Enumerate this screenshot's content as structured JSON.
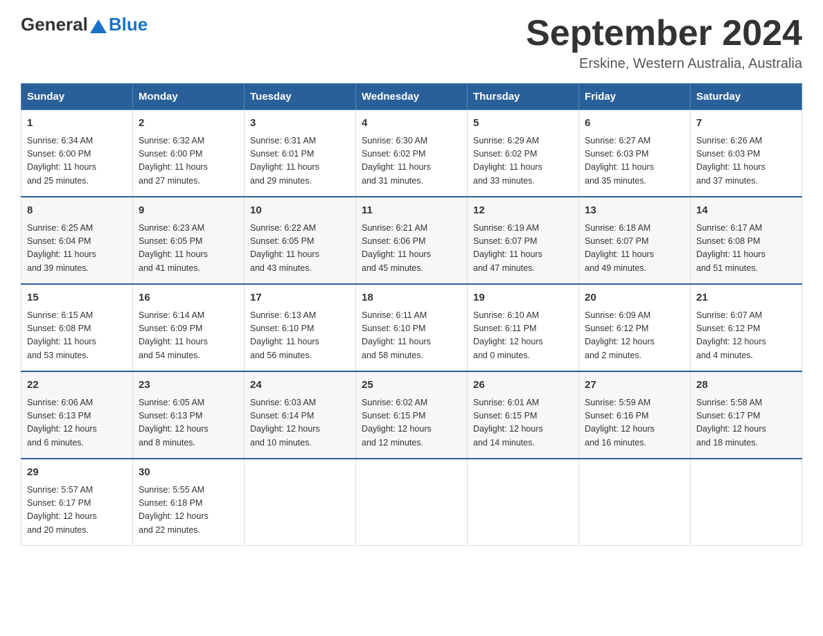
{
  "header": {
    "logo_general": "General",
    "logo_blue": "Blue",
    "month_title": "September 2024",
    "location": "Erskine, Western Australia, Australia"
  },
  "weekdays": [
    "Sunday",
    "Monday",
    "Tuesday",
    "Wednesday",
    "Thursday",
    "Friday",
    "Saturday"
  ],
  "weeks": [
    [
      {
        "day": "1",
        "sunrise": "6:34 AM",
        "sunset": "6:00 PM",
        "daylight": "11 hours and 25 minutes."
      },
      {
        "day": "2",
        "sunrise": "6:32 AM",
        "sunset": "6:00 PM",
        "daylight": "11 hours and 27 minutes."
      },
      {
        "day": "3",
        "sunrise": "6:31 AM",
        "sunset": "6:01 PM",
        "daylight": "11 hours and 29 minutes."
      },
      {
        "day": "4",
        "sunrise": "6:30 AM",
        "sunset": "6:02 PM",
        "daylight": "11 hours and 31 minutes."
      },
      {
        "day": "5",
        "sunrise": "6:29 AM",
        "sunset": "6:02 PM",
        "daylight": "11 hours and 33 minutes."
      },
      {
        "day": "6",
        "sunrise": "6:27 AM",
        "sunset": "6:03 PM",
        "daylight": "11 hours and 35 minutes."
      },
      {
        "day": "7",
        "sunrise": "6:26 AM",
        "sunset": "6:03 PM",
        "daylight": "11 hours and 37 minutes."
      }
    ],
    [
      {
        "day": "8",
        "sunrise": "6:25 AM",
        "sunset": "6:04 PM",
        "daylight": "11 hours and 39 minutes."
      },
      {
        "day": "9",
        "sunrise": "6:23 AM",
        "sunset": "6:05 PM",
        "daylight": "11 hours and 41 minutes."
      },
      {
        "day": "10",
        "sunrise": "6:22 AM",
        "sunset": "6:05 PM",
        "daylight": "11 hours and 43 minutes."
      },
      {
        "day": "11",
        "sunrise": "6:21 AM",
        "sunset": "6:06 PM",
        "daylight": "11 hours and 45 minutes."
      },
      {
        "day": "12",
        "sunrise": "6:19 AM",
        "sunset": "6:07 PM",
        "daylight": "11 hours and 47 minutes."
      },
      {
        "day": "13",
        "sunrise": "6:18 AM",
        "sunset": "6:07 PM",
        "daylight": "11 hours and 49 minutes."
      },
      {
        "day": "14",
        "sunrise": "6:17 AM",
        "sunset": "6:08 PM",
        "daylight": "11 hours and 51 minutes."
      }
    ],
    [
      {
        "day": "15",
        "sunrise": "6:15 AM",
        "sunset": "6:08 PM",
        "daylight": "11 hours and 53 minutes."
      },
      {
        "day": "16",
        "sunrise": "6:14 AM",
        "sunset": "6:09 PM",
        "daylight": "11 hours and 54 minutes."
      },
      {
        "day": "17",
        "sunrise": "6:13 AM",
        "sunset": "6:10 PM",
        "daylight": "11 hours and 56 minutes."
      },
      {
        "day": "18",
        "sunrise": "6:11 AM",
        "sunset": "6:10 PM",
        "daylight": "11 hours and 58 minutes."
      },
      {
        "day": "19",
        "sunrise": "6:10 AM",
        "sunset": "6:11 PM",
        "daylight": "12 hours and 0 minutes."
      },
      {
        "day": "20",
        "sunrise": "6:09 AM",
        "sunset": "6:12 PM",
        "daylight": "12 hours and 2 minutes."
      },
      {
        "day": "21",
        "sunrise": "6:07 AM",
        "sunset": "6:12 PM",
        "daylight": "12 hours and 4 minutes."
      }
    ],
    [
      {
        "day": "22",
        "sunrise": "6:06 AM",
        "sunset": "6:13 PM",
        "daylight": "12 hours and 6 minutes."
      },
      {
        "day": "23",
        "sunrise": "6:05 AM",
        "sunset": "6:13 PM",
        "daylight": "12 hours and 8 minutes."
      },
      {
        "day": "24",
        "sunrise": "6:03 AM",
        "sunset": "6:14 PM",
        "daylight": "12 hours and 10 minutes."
      },
      {
        "day": "25",
        "sunrise": "6:02 AM",
        "sunset": "6:15 PM",
        "daylight": "12 hours and 12 minutes."
      },
      {
        "day": "26",
        "sunrise": "6:01 AM",
        "sunset": "6:15 PM",
        "daylight": "12 hours and 14 minutes."
      },
      {
        "day": "27",
        "sunrise": "5:59 AM",
        "sunset": "6:16 PM",
        "daylight": "12 hours and 16 minutes."
      },
      {
        "day": "28",
        "sunrise": "5:58 AM",
        "sunset": "6:17 PM",
        "daylight": "12 hours and 18 minutes."
      }
    ],
    [
      {
        "day": "29",
        "sunrise": "5:57 AM",
        "sunset": "6:17 PM",
        "daylight": "12 hours and 20 minutes."
      },
      {
        "day": "30",
        "sunrise": "5:55 AM",
        "sunset": "6:18 PM",
        "daylight": "12 hours and 22 minutes."
      },
      null,
      null,
      null,
      null,
      null
    ]
  ],
  "labels": {
    "sunrise": "Sunrise:",
    "sunset": "Sunset:",
    "daylight": "Daylight:"
  }
}
